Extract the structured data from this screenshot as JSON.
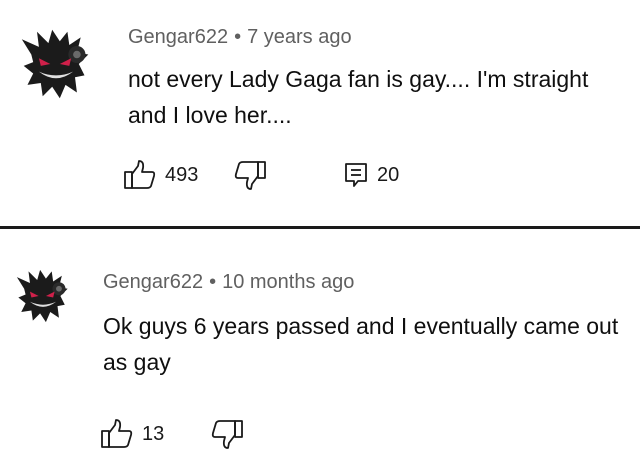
{
  "comments": [
    {
      "author": "Gengar622",
      "separator": "•",
      "time": "7 years ago",
      "text": "not every Lady Gaga fan is gay.... I'm straight and I love her....",
      "likes": "493",
      "replies": "20",
      "avatar_icon": "gengar-avatar-icon"
    },
    {
      "author": "Gengar622",
      "separator": "•",
      "time": "10 months ago",
      "text": "Ok guys 6 years passed and I eventually came out as gay",
      "likes": "13",
      "avatar_icon": "gengar-avatar-icon"
    }
  ],
  "icons": {
    "like": "thumbs-up-icon",
    "dislike": "thumbs-down-icon",
    "reply": "reply-comment-icon"
  },
  "colors": {
    "meta_text": "#606060",
    "body_text": "#0f0f0f",
    "avatar_body": "#1b1b1b",
    "avatar_eyes": "#d0204a",
    "divider": "#1a1a1a"
  }
}
